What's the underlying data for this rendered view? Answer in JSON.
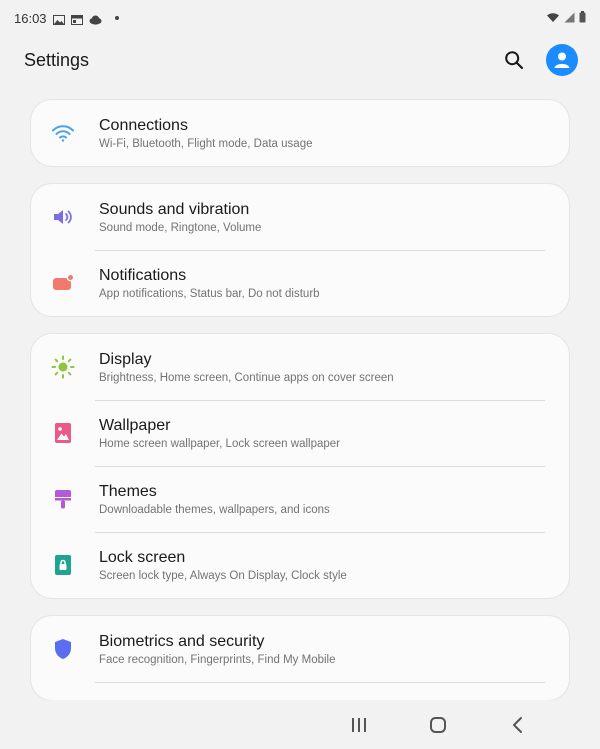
{
  "status_bar": {
    "time": "16:03",
    "left_icons": [
      "gallery-icon",
      "calendar-icon",
      "cloud-icon"
    ],
    "right_icons": [
      "wifi-icon",
      "signal-icon",
      "battery-icon"
    ]
  },
  "header": {
    "title": "Settings",
    "search_icon": "search-icon",
    "avatar_icon": "person-icon",
    "accent": "#1a8cff"
  },
  "groups": [
    {
      "items": [
        {
          "id": "connections",
          "title": "Connections",
          "subtitle": "Wi-Fi, Bluetooth, Flight mode, Data usage",
          "icon": "wifi-icon",
          "color": "#4aa3e8"
        }
      ]
    },
    {
      "items": [
        {
          "id": "sounds",
          "title": "Sounds and vibration",
          "subtitle": "Sound mode, Ringtone, Volume",
          "icon": "speaker-icon",
          "color": "#7b6fe0"
        },
        {
          "id": "notifications",
          "title": "Notifications",
          "subtitle": "App notifications, Status bar, Do not disturb",
          "icon": "notification-icon",
          "color": "#f07a6c"
        }
      ]
    },
    {
      "items": [
        {
          "id": "display",
          "title": "Display",
          "subtitle": "Brightness, Home screen, Continue apps on cover screen",
          "icon": "sun-icon",
          "color": "#8cc63f"
        },
        {
          "id": "wallpaper",
          "title": "Wallpaper",
          "subtitle": "Home screen wallpaper, Lock screen wallpaper",
          "icon": "image-icon",
          "color": "#e75a8a"
        },
        {
          "id": "themes",
          "title": "Themes",
          "subtitle": "Downloadable themes, wallpapers, and icons",
          "icon": "brush-icon",
          "color": "#b45ad8"
        },
        {
          "id": "lock",
          "title": "Lock screen",
          "subtitle": "Screen lock type, Always On Display, Clock style",
          "icon": "lock-icon",
          "color": "#1fa395"
        }
      ]
    },
    {
      "items": [
        {
          "id": "biometrics",
          "title": "Biometrics and security",
          "subtitle": "Face recognition, Fingerprints, Find My Mobile",
          "icon": "shield-icon",
          "color": "#5b6ef0"
        }
      ]
    }
  ],
  "nav_bar": {
    "buttons": [
      "recents-icon",
      "home-icon",
      "back-icon"
    ]
  }
}
